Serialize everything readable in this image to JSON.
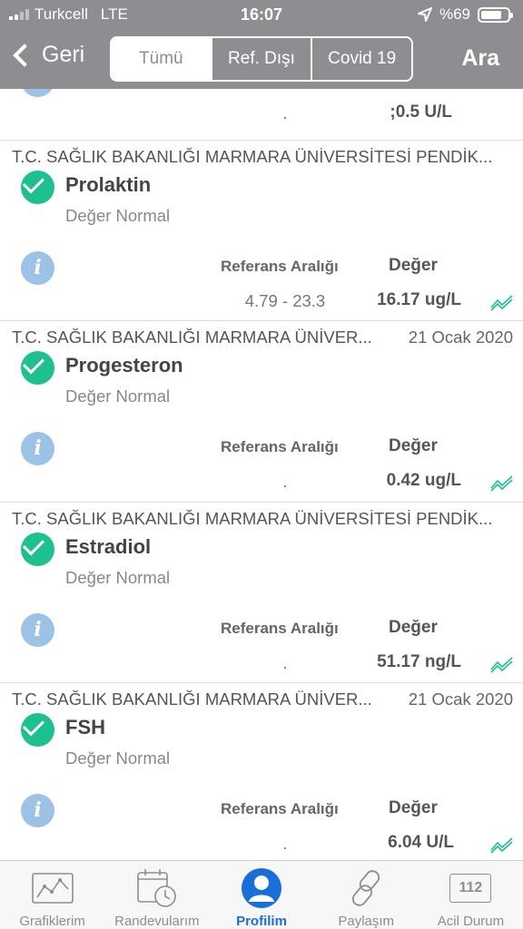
{
  "status_bar": {
    "carrier": "Turkcell",
    "network": "LTE",
    "time": "16:07",
    "battery": "%69"
  },
  "nav": {
    "back_label": "Geri",
    "segments": [
      "Tümü",
      "Ref. Dışı",
      "Covid 19"
    ],
    "active_segment": "Tümü",
    "search_label": "Ara"
  },
  "colors": {
    "header_bg": "#8e8e92",
    "check_green": "#1ec08f",
    "info_blue": "#9cc2e6",
    "tab_active": "#1a6fd6",
    "trend_green": "#1ec08f"
  },
  "labels": {
    "ref_range": "Referans Aralığı",
    "value": "Değer"
  },
  "partial_card": {
    "ref_range": ".",
    "value": ";0.5 U/L"
  },
  "results": [
    {
      "institution": "T.C. SAĞLIK BAKANLIĞI MARMARA ÜNİVERSİTESİ PENDİK...",
      "date": "",
      "test": "Prolaktin",
      "status": "Değer Normal",
      "ref_range": "4.79 - 23.3",
      "value": "16.17 ug/L"
    },
    {
      "institution": "T.C. SAĞLIK BAKANLIĞI MARMARA ÜNİVER...",
      "date": "21 Ocak 2020",
      "test": "Progesteron",
      "status": "Değer Normal",
      "ref_range": ".",
      "value": "0.42 ug/L"
    },
    {
      "institution": "T.C. SAĞLIK BAKANLIĞI MARMARA ÜNİVERSİTESİ PENDİK...",
      "date": "",
      "test": "Estradiol",
      "status": "Değer Normal",
      "ref_range": ".",
      "value": "51.17 ng/L"
    },
    {
      "institution": "T.C. SAĞLIK BAKANLIĞI MARMARA ÜNİVER...",
      "date": "21 Ocak 2020",
      "test": "FSH",
      "status": "Değer Normal",
      "ref_range": ".",
      "value": "6.04 U/L"
    }
  ],
  "tabbar": {
    "active": "Profilim",
    "items": [
      {
        "label": "Grafiklerim",
        "icon": "chart-icon"
      },
      {
        "label": "Randevularım",
        "icon": "calendar-clock-icon"
      },
      {
        "label": "Profilim",
        "icon": "person-icon"
      },
      {
        "label": "Paylaşım",
        "icon": "link-icon"
      },
      {
        "label": "Acil Durum",
        "icon": "emergency-112-icon",
        "badge": "112"
      }
    ]
  }
}
